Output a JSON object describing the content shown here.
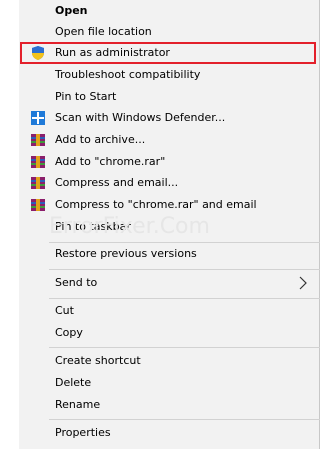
{
  "menu": {
    "open": "Open",
    "open_file_location": "Open file location",
    "run_as_admin": "Run as administrator",
    "troubleshoot": "Troubleshoot compatibility",
    "pin_start": "Pin to Start",
    "scan_defender": "Scan with Windows Defender...",
    "add_archive": "Add to archive...",
    "add_chrome_rar": "Add to \"chrome.rar\"",
    "compress_email": "Compress and email...",
    "compress_chrome_email": "Compress to \"chrome.rar\" and email",
    "pin_taskbar": "Pin to taskbar",
    "restore": "Restore previous versions",
    "send_to": "Send to",
    "cut": "Cut",
    "copy": "Copy",
    "create_shortcut": "Create shortcut",
    "delete": "Delete",
    "rename": "Rename",
    "properties": "Properties"
  },
  "watermark": "ErrorFixer.Com",
  "icons": {
    "run_as_admin": "uac-shield-icon",
    "scan_defender": "windows-defender-icon",
    "add_archive": "winrar-icon",
    "add_chrome_rar": "winrar-icon",
    "compress_email": "winrar-icon",
    "compress_chrome_email": "winrar-icon",
    "send_to": "chevron-right-icon"
  },
  "colors": {
    "highlight_border": "#e3202b",
    "menu_background": "#f2f2f2"
  }
}
